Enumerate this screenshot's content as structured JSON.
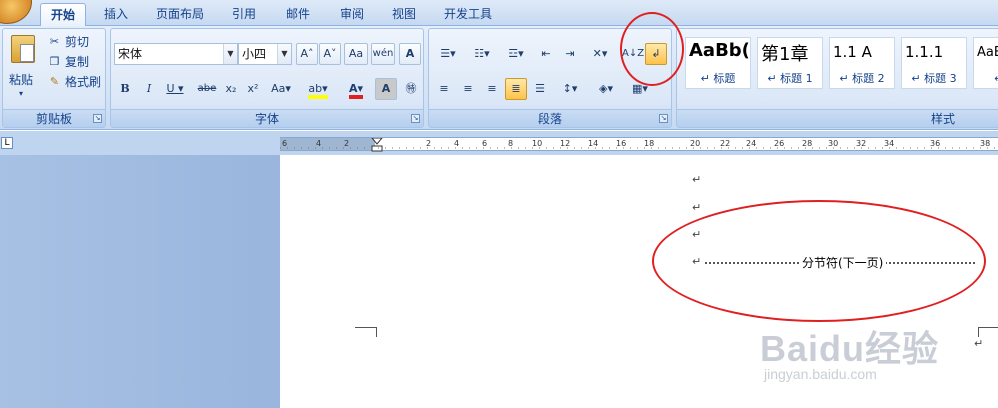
{
  "tabs": [
    "开始",
    "插入",
    "页面布局",
    "引用",
    "邮件",
    "审阅",
    "视图",
    "开发工具"
  ],
  "clipboard": {
    "paste_label": "粘贴",
    "cut_label": "剪切",
    "copy_label": "复制",
    "format_painter_label": "格式刷",
    "group_label": "剪贴板"
  },
  "font": {
    "font_name": "宋体",
    "font_size": "小四",
    "group_label": "字体"
  },
  "paragraph": {
    "group_label": "段落",
    "show_marks_active": true
  },
  "styles": {
    "group_label": "样式",
    "items": [
      {
        "sample": "AaBb(",
        "name": "标题"
      },
      {
        "sample": "第1章",
        "name": "标题 1"
      },
      {
        "sample": "1.1 A",
        "name": "标题 2"
      },
      {
        "sample": "1.1.1",
        "name": "标题 3"
      },
      {
        "sample": "AaBb",
        "name": "标"
      }
    ]
  },
  "ruler": {
    "numbers": [
      "6",
      "4",
      "2",
      "2",
      "4",
      "6",
      "8",
      "10",
      "12",
      "14",
      "16",
      "18",
      "20",
      "22",
      "24",
      "26",
      "28",
      "30",
      "32",
      "34",
      "36",
      "38"
    ]
  },
  "document": {
    "para_mark": "↵",
    "section_break_text": "分节符(下一页)"
  },
  "watermark": {
    "brand": "Baidu经验",
    "url": "jingyan.baidu.com"
  },
  "colors": {
    "annotation_red": "#e02020",
    "highlight_orange": "#ffc24a"
  }
}
